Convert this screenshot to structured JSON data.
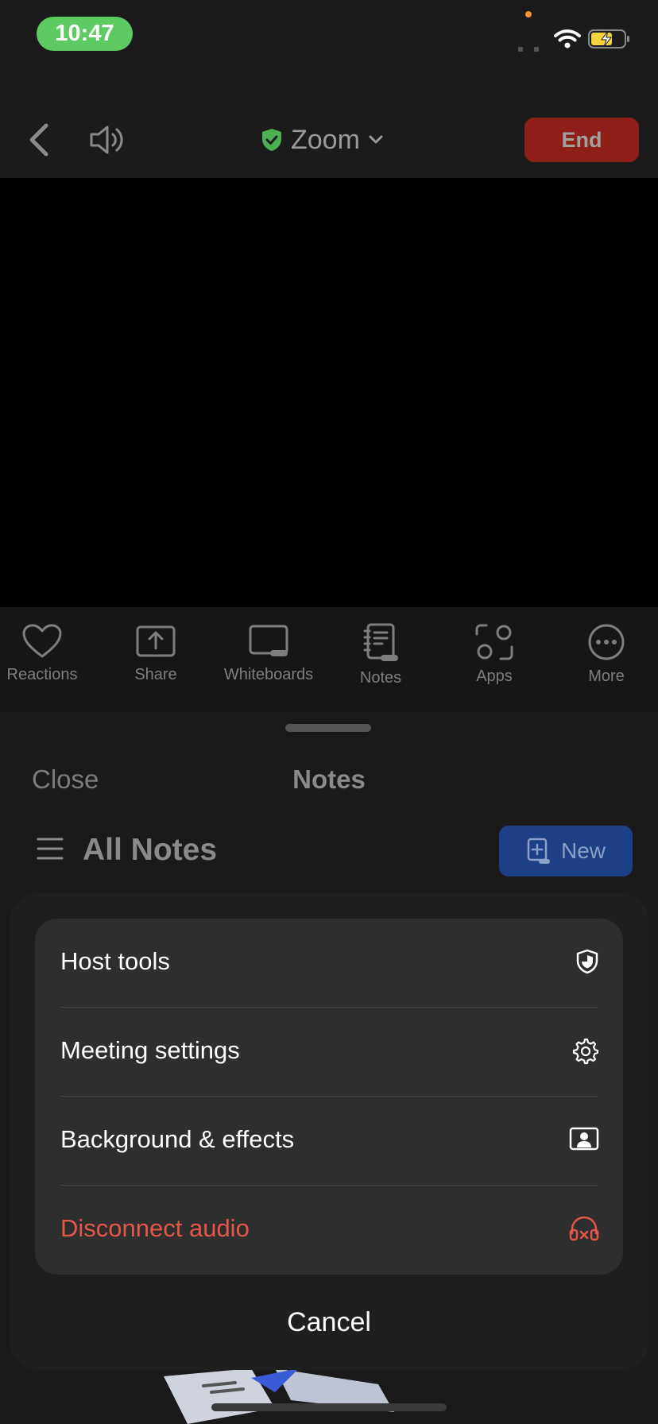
{
  "status_bar": {
    "time": "10:47",
    "icons": [
      "signal-icon",
      "wifi-icon",
      "battery-charging-icon"
    ]
  },
  "meeting_header": {
    "title": "Zoom",
    "end_label": "End",
    "icons": [
      "back-icon",
      "speaker-icon",
      "shield-check-icon",
      "chevron-down-icon"
    ]
  },
  "toolbar": {
    "items": [
      {
        "label": "Reactions",
        "icon": "heart-icon"
      },
      {
        "label": "Share",
        "icon": "share-upload-icon"
      },
      {
        "label": "Whiteboards",
        "icon": "whiteboard-icon"
      },
      {
        "label": "Notes",
        "icon": "notes-icon"
      },
      {
        "label": "Apps",
        "icon": "apps-icon"
      },
      {
        "label": "More",
        "icon": "more-icon"
      }
    ]
  },
  "notes_panel": {
    "close_label": "Close",
    "title": "Notes",
    "list_title": "All Notes",
    "new_label": "New"
  },
  "action_sheet": {
    "options": [
      {
        "label": "Host tools",
        "icon": "shield-icon"
      },
      {
        "label": "Meeting settings",
        "icon": "gear-icon"
      },
      {
        "label": "Background & effects",
        "icon": "portrait-frame-icon"
      },
      {
        "label": "Disconnect audio",
        "icon": "headphones-off-icon",
        "color": "#e5574a"
      }
    ],
    "cancel_label": "Cancel"
  },
  "colors": {
    "end_button": "#8f2019",
    "new_button": "#1d3f86",
    "time_pill": "#5ecb62",
    "danger": "#e5574a",
    "shield_green": "#4caf50"
  }
}
